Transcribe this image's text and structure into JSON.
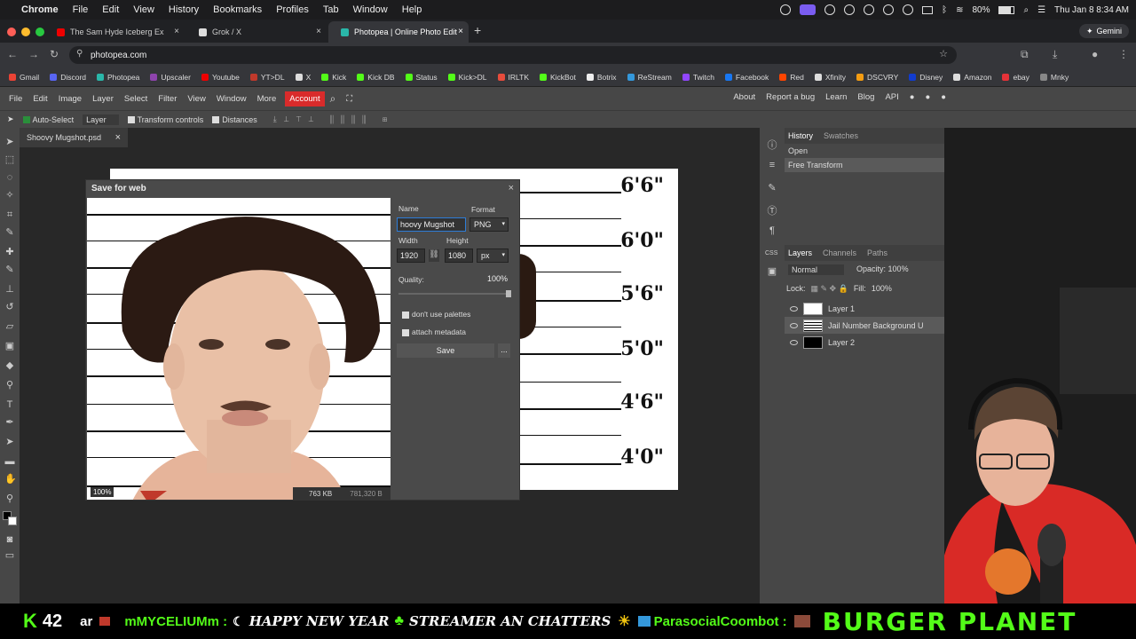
{
  "macmenu": {
    "apple": "",
    "items": [
      "Chrome",
      "File",
      "Edit",
      "View",
      "History",
      "Bookmarks",
      "Profiles",
      "Tab",
      "Window",
      "Help"
    ],
    "battery": "80%",
    "clock": "Thu Jan 8  8:34 AM"
  },
  "tabs": [
    {
      "title": "The Sam Hyde Iceberg Ex"
    },
    {
      "title": "Grok / X"
    },
    {
      "title": "Photopea | Online Photo Edit"
    }
  ],
  "gemini": "Gemini",
  "address": "photopea.com",
  "bookmarks": [
    "Gmail",
    "Discord",
    "Photopea",
    "Upscaler",
    "Youtube",
    "YT>DL",
    "X",
    "Kick",
    "Kick DB",
    "Status",
    "Kick>DL",
    "IRLTK",
    "KickBot",
    "Botrix",
    "ReStream",
    "Twitch",
    "Facebook",
    "Red",
    "Xfinity",
    "DSCVRY",
    "Disney",
    "Amazon",
    "ebay",
    "Mnky"
  ],
  "ppmenu": {
    "items": [
      "File",
      "Edit",
      "Image",
      "Layer",
      "Select",
      "Filter",
      "View",
      "Window",
      "More"
    ],
    "account": "Account",
    "links": [
      "About",
      "Report a bug",
      "Learn",
      "Blog",
      "API"
    ]
  },
  "options": {
    "autoselect": "Auto-Select",
    "layer": "Layer",
    "transform": "Transform controls",
    "distances": "Distances"
  },
  "doc": {
    "tab": "Shoovy Mugshot.psd"
  },
  "canvas": {
    "marks": [
      "6'6\"",
      "6'0\"",
      "5'6\"",
      "5'0\"",
      "4'6\"",
      "4'0\""
    ]
  },
  "history": {
    "tabs": [
      "History",
      "Swatches"
    ],
    "items": [
      "Open",
      "Free Transform"
    ]
  },
  "layers": {
    "tabs": [
      "Layers",
      "Channels",
      "Paths"
    ],
    "blend": "Normal",
    "opacity_label": "Opacity:",
    "opacity": "100%",
    "lock": "Lock:",
    "fill_label": "Fill:",
    "fill": "100%",
    "items": [
      "Layer 1",
      "Jail Number Background U",
      "Layer 2"
    ]
  },
  "dialog": {
    "title": "Save for web",
    "name_label": "Name",
    "name": "hoovy Mugshot",
    "format_label": "Format",
    "format": "PNG",
    "width_label": "Width",
    "height_label": "Height",
    "width": "1920",
    "height": "1080",
    "unit": "px",
    "quality_label": "Quality:",
    "quality": "100%",
    "palettes": "don't use palettes",
    "metadata": "attach metadata",
    "save": "Save",
    "more": "...",
    "zoom": "100%",
    "size": "763 KB",
    "bytes": "781,320 B"
  },
  "ticker": {
    "k": "K",
    "count": "42",
    "parts": [
      "ar",
      "mMYCELIUMm :",
      "HAPPY NEW YEAR",
      "STREAMER AN CHATTERS",
      "ParasocialCoombot :",
      "BURGER PLANET"
    ]
  }
}
